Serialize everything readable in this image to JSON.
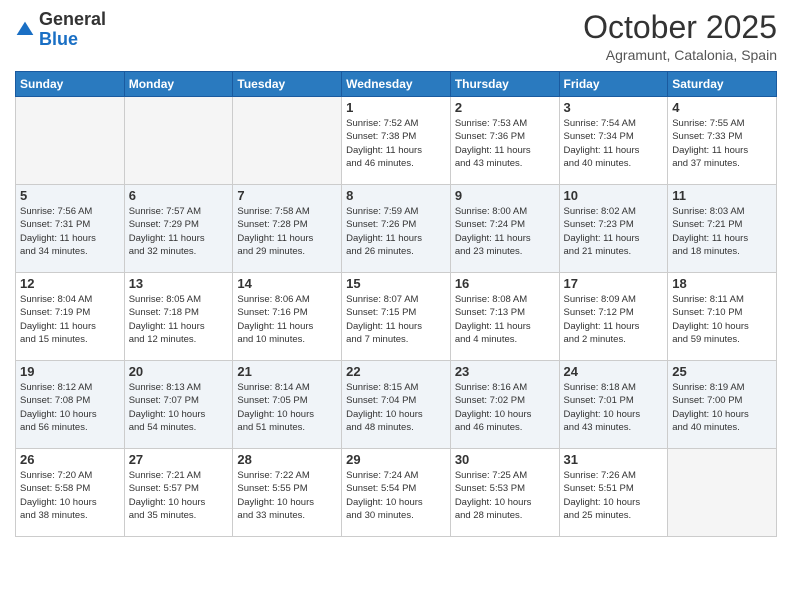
{
  "logo": {
    "general": "General",
    "blue": "Blue"
  },
  "header": {
    "month": "October 2025",
    "location": "Agramunt, Catalonia, Spain"
  },
  "weekdays": [
    "Sunday",
    "Monday",
    "Tuesday",
    "Wednesday",
    "Thursday",
    "Friday",
    "Saturday"
  ],
  "rows": [
    [
      {
        "day": "",
        "info": ""
      },
      {
        "day": "",
        "info": ""
      },
      {
        "day": "",
        "info": ""
      },
      {
        "day": "1",
        "info": "Sunrise: 7:52 AM\nSunset: 7:38 PM\nDaylight: 11 hours\nand 46 minutes."
      },
      {
        "day": "2",
        "info": "Sunrise: 7:53 AM\nSunset: 7:36 PM\nDaylight: 11 hours\nand 43 minutes."
      },
      {
        "day": "3",
        "info": "Sunrise: 7:54 AM\nSunset: 7:34 PM\nDaylight: 11 hours\nand 40 minutes."
      },
      {
        "day": "4",
        "info": "Sunrise: 7:55 AM\nSunset: 7:33 PM\nDaylight: 11 hours\nand 37 minutes."
      }
    ],
    [
      {
        "day": "5",
        "info": "Sunrise: 7:56 AM\nSunset: 7:31 PM\nDaylight: 11 hours\nand 34 minutes."
      },
      {
        "day": "6",
        "info": "Sunrise: 7:57 AM\nSunset: 7:29 PM\nDaylight: 11 hours\nand 32 minutes."
      },
      {
        "day": "7",
        "info": "Sunrise: 7:58 AM\nSunset: 7:28 PM\nDaylight: 11 hours\nand 29 minutes."
      },
      {
        "day": "8",
        "info": "Sunrise: 7:59 AM\nSunset: 7:26 PM\nDaylight: 11 hours\nand 26 minutes."
      },
      {
        "day": "9",
        "info": "Sunrise: 8:00 AM\nSunset: 7:24 PM\nDaylight: 11 hours\nand 23 minutes."
      },
      {
        "day": "10",
        "info": "Sunrise: 8:02 AM\nSunset: 7:23 PM\nDaylight: 11 hours\nand 21 minutes."
      },
      {
        "day": "11",
        "info": "Sunrise: 8:03 AM\nSunset: 7:21 PM\nDaylight: 11 hours\nand 18 minutes."
      }
    ],
    [
      {
        "day": "12",
        "info": "Sunrise: 8:04 AM\nSunset: 7:19 PM\nDaylight: 11 hours\nand 15 minutes."
      },
      {
        "day": "13",
        "info": "Sunrise: 8:05 AM\nSunset: 7:18 PM\nDaylight: 11 hours\nand 12 minutes."
      },
      {
        "day": "14",
        "info": "Sunrise: 8:06 AM\nSunset: 7:16 PM\nDaylight: 11 hours\nand 10 minutes."
      },
      {
        "day": "15",
        "info": "Sunrise: 8:07 AM\nSunset: 7:15 PM\nDaylight: 11 hours\nand 7 minutes."
      },
      {
        "day": "16",
        "info": "Sunrise: 8:08 AM\nSunset: 7:13 PM\nDaylight: 11 hours\nand 4 minutes."
      },
      {
        "day": "17",
        "info": "Sunrise: 8:09 AM\nSunset: 7:12 PM\nDaylight: 11 hours\nand 2 minutes."
      },
      {
        "day": "18",
        "info": "Sunrise: 8:11 AM\nSunset: 7:10 PM\nDaylight: 10 hours\nand 59 minutes."
      }
    ],
    [
      {
        "day": "19",
        "info": "Sunrise: 8:12 AM\nSunset: 7:08 PM\nDaylight: 10 hours\nand 56 minutes."
      },
      {
        "day": "20",
        "info": "Sunrise: 8:13 AM\nSunset: 7:07 PM\nDaylight: 10 hours\nand 54 minutes."
      },
      {
        "day": "21",
        "info": "Sunrise: 8:14 AM\nSunset: 7:05 PM\nDaylight: 10 hours\nand 51 minutes."
      },
      {
        "day": "22",
        "info": "Sunrise: 8:15 AM\nSunset: 7:04 PM\nDaylight: 10 hours\nand 48 minutes."
      },
      {
        "day": "23",
        "info": "Sunrise: 8:16 AM\nSunset: 7:02 PM\nDaylight: 10 hours\nand 46 minutes."
      },
      {
        "day": "24",
        "info": "Sunrise: 8:18 AM\nSunset: 7:01 PM\nDaylight: 10 hours\nand 43 minutes."
      },
      {
        "day": "25",
        "info": "Sunrise: 8:19 AM\nSunset: 7:00 PM\nDaylight: 10 hours\nand 40 minutes."
      }
    ],
    [
      {
        "day": "26",
        "info": "Sunrise: 7:20 AM\nSunset: 5:58 PM\nDaylight: 10 hours\nand 38 minutes."
      },
      {
        "day": "27",
        "info": "Sunrise: 7:21 AM\nSunset: 5:57 PM\nDaylight: 10 hours\nand 35 minutes."
      },
      {
        "day": "28",
        "info": "Sunrise: 7:22 AM\nSunset: 5:55 PM\nDaylight: 10 hours\nand 33 minutes."
      },
      {
        "day": "29",
        "info": "Sunrise: 7:24 AM\nSunset: 5:54 PM\nDaylight: 10 hours\nand 30 minutes."
      },
      {
        "day": "30",
        "info": "Sunrise: 7:25 AM\nSunset: 5:53 PM\nDaylight: 10 hours\nand 28 minutes."
      },
      {
        "day": "31",
        "info": "Sunrise: 7:26 AM\nSunset: 5:51 PM\nDaylight: 10 hours\nand 25 minutes."
      },
      {
        "day": "",
        "info": ""
      }
    ]
  ]
}
